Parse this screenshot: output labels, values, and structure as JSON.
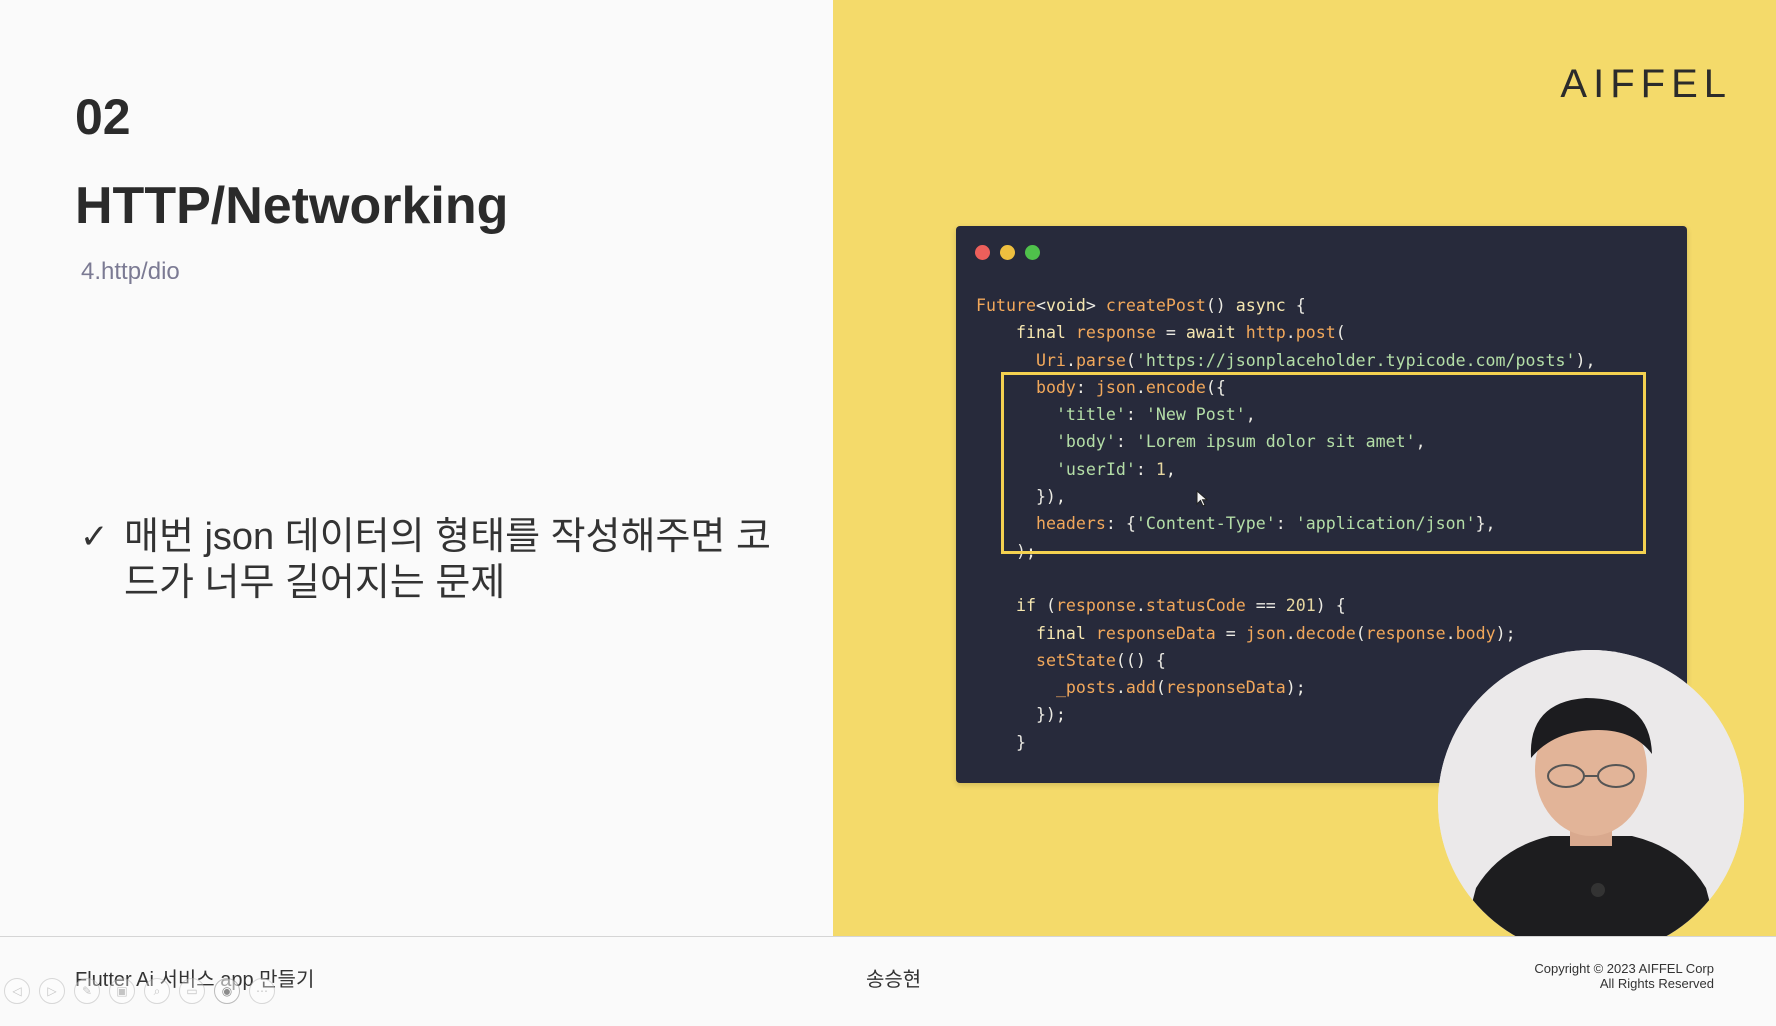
{
  "slide": {
    "section_number": "02",
    "section_title": "HTTP/Networking",
    "section_subtitle": "4.http/dio",
    "bullet_mark": "✓",
    "bullet_text": "매번 json 데이터의 형태를 작성해주면 코드가 너무 길어지는 문제",
    "brand": "AIFFEL"
  },
  "code_window": {
    "lines": [
      [
        {
          "t": "Future",
          "c": "fn"
        },
        {
          "t": "<",
          "c": "plain"
        },
        {
          "t": "void",
          "c": "kw"
        },
        {
          "t": "> ",
          "c": "plain"
        },
        {
          "t": "createPost",
          "c": "fn"
        },
        {
          "t": "() ",
          "c": "plain"
        },
        {
          "t": "async",
          "c": "kw"
        },
        {
          "t": " {",
          "c": "plain"
        }
      ],
      [
        {
          "t": "    ",
          "c": "plain"
        },
        {
          "t": "final",
          "c": "kw"
        },
        {
          "t": " ",
          "c": "plain"
        },
        {
          "t": "response",
          "c": "fn"
        },
        {
          "t": " = ",
          "c": "plain"
        },
        {
          "t": "await",
          "c": "kw"
        },
        {
          "t": " ",
          "c": "plain"
        },
        {
          "t": "http",
          "c": "fn"
        },
        {
          "t": ".",
          "c": "plain"
        },
        {
          "t": "post",
          "c": "fn"
        },
        {
          "t": "(",
          "c": "plain"
        }
      ],
      [
        {
          "t": "      ",
          "c": "plain"
        },
        {
          "t": "Uri",
          "c": "fn"
        },
        {
          "t": ".",
          "c": "plain"
        },
        {
          "t": "parse",
          "c": "fn"
        },
        {
          "t": "(",
          "c": "plain"
        },
        {
          "t": "'https://jsonplaceholder.typicode.com/posts'",
          "c": "str"
        },
        {
          "t": "),",
          "c": "plain"
        }
      ],
      [
        {
          "t": "      ",
          "c": "plain"
        },
        {
          "t": "body",
          "c": "fn"
        },
        {
          "t": ": ",
          "c": "plain"
        },
        {
          "t": "json",
          "c": "fn"
        },
        {
          "t": ".",
          "c": "plain"
        },
        {
          "t": "encode",
          "c": "fn"
        },
        {
          "t": "({",
          "c": "plain"
        }
      ],
      [
        {
          "t": "        ",
          "c": "plain"
        },
        {
          "t": "'title'",
          "c": "str"
        },
        {
          "t": ": ",
          "c": "plain"
        },
        {
          "t": "'New Post'",
          "c": "str"
        },
        {
          "t": ",",
          "c": "plain"
        }
      ],
      [
        {
          "t": "        ",
          "c": "plain"
        },
        {
          "t": "'body'",
          "c": "str"
        },
        {
          "t": ": ",
          "c": "plain"
        },
        {
          "t": "'Lorem ipsum dolor sit amet'",
          "c": "str"
        },
        {
          "t": ",",
          "c": "plain"
        }
      ],
      [
        {
          "t": "        ",
          "c": "plain"
        },
        {
          "t": "'userId'",
          "c": "str"
        },
        {
          "t": ": ",
          "c": "plain"
        },
        {
          "t": "1",
          "c": "num"
        },
        {
          "t": ",",
          "c": "plain"
        }
      ],
      [
        {
          "t": "      }),",
          "c": "plain"
        }
      ],
      [
        {
          "t": "      ",
          "c": "plain"
        },
        {
          "t": "headers",
          "c": "fn"
        },
        {
          "t": ": {",
          "c": "plain"
        },
        {
          "t": "'Content-Type'",
          "c": "str"
        },
        {
          "t": ": ",
          "c": "plain"
        },
        {
          "t": "'application/json'",
          "c": "str"
        },
        {
          "t": "},",
          "c": "plain"
        }
      ],
      [
        {
          "t": "    );",
          "c": "plain"
        }
      ],
      [],
      [
        {
          "t": "    ",
          "c": "plain"
        },
        {
          "t": "if",
          "c": "kw"
        },
        {
          "t": " (",
          "c": "plain"
        },
        {
          "t": "response",
          "c": "fn"
        },
        {
          "t": ".",
          "c": "plain"
        },
        {
          "t": "statusCode",
          "c": "fn"
        },
        {
          "t": " == ",
          "c": "plain"
        },
        {
          "t": "201",
          "c": "num"
        },
        {
          "t": ") {",
          "c": "plain"
        }
      ],
      [
        {
          "t": "      ",
          "c": "plain"
        },
        {
          "t": "final",
          "c": "kw"
        },
        {
          "t": " ",
          "c": "plain"
        },
        {
          "t": "responseData",
          "c": "fn"
        },
        {
          "t": " = ",
          "c": "plain"
        },
        {
          "t": "json",
          "c": "fn"
        },
        {
          "t": ".",
          "c": "plain"
        },
        {
          "t": "decode",
          "c": "fn"
        },
        {
          "t": "(",
          "c": "plain"
        },
        {
          "t": "response",
          "c": "fn"
        },
        {
          "t": ".",
          "c": "plain"
        },
        {
          "t": "body",
          "c": "fn"
        },
        {
          "t": ");",
          "c": "plain"
        }
      ],
      [
        {
          "t": "      ",
          "c": "plain"
        },
        {
          "t": "setState",
          "c": "fn"
        },
        {
          "t": "(() {",
          "c": "plain"
        }
      ],
      [
        {
          "t": "        ",
          "c": "plain"
        },
        {
          "t": "_posts",
          "c": "fn"
        },
        {
          "t": ".",
          "c": "plain"
        },
        {
          "t": "add",
          "c": "fn"
        },
        {
          "t": "(",
          "c": "plain"
        },
        {
          "t": "responseData",
          "c": "fn"
        },
        {
          "t": ");",
          "c": "plain"
        }
      ],
      [
        {
          "t": "      });",
          "c": "plain"
        }
      ],
      [
        {
          "t": "    }",
          "c": "plain"
        }
      ]
    ]
  },
  "footer": {
    "course_title": "Flutter Ai 서비스 app 만들기",
    "presenter": "송승현",
    "copyright_line1": "Copyright © 2023 AIFFEL Corp",
    "copyright_line2": "All Rights Reserved"
  },
  "player_controls": [
    {
      "name": "prev-slide-icon",
      "glyph": "◁"
    },
    {
      "name": "next-slide-icon",
      "glyph": "▷"
    },
    {
      "name": "pen-icon",
      "glyph": "✎"
    },
    {
      "name": "slides-icon",
      "glyph": "▣"
    },
    {
      "name": "zoom-icon",
      "glyph": "⌕"
    },
    {
      "name": "subtitles-icon",
      "glyph": "▭"
    },
    {
      "name": "camera-icon",
      "glyph": "◉",
      "active": true
    },
    {
      "name": "more-icon",
      "glyph": "⋯"
    }
  ]
}
